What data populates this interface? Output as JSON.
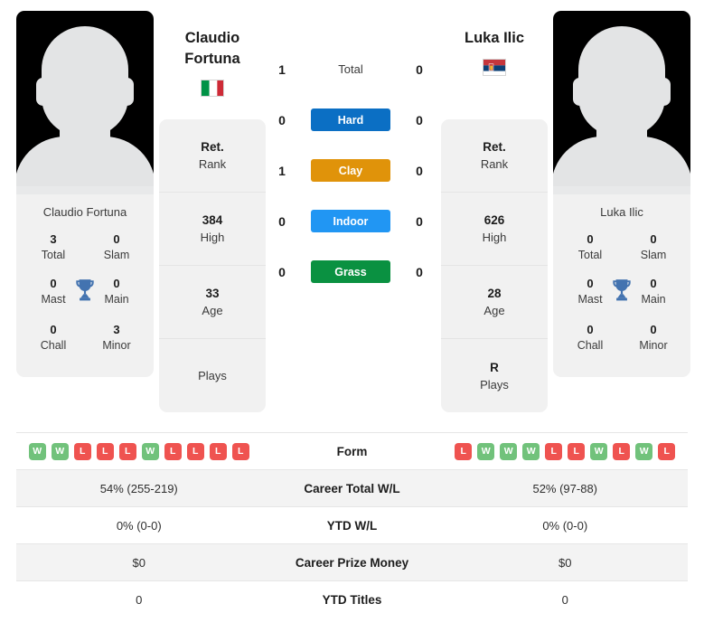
{
  "players": {
    "left": {
      "name": "Claudio Fortuna",
      "name_line1": "Claudio",
      "name_line2": "Fortuna",
      "country": "Italy",
      "flag": "italy-flag",
      "photo": "player-photo-placeholder",
      "titles": {
        "total_value": "3",
        "total_label": "Total",
        "slam_value": "0",
        "slam_label": "Slam",
        "mast_value": "0",
        "mast_label": "Mast",
        "main_value": "0",
        "main_label": "Main",
        "chall_value": "0",
        "chall_label": "Chall",
        "minor_value": "3",
        "minor_label": "Minor"
      },
      "rank": {
        "rank_value": "Ret.",
        "rank_label": "Rank",
        "high_value": "384",
        "high_label": "High",
        "age_value": "33",
        "age_label": "Age",
        "plays_value": "",
        "plays_label": "Plays"
      },
      "form": [
        "W",
        "W",
        "L",
        "L",
        "L",
        "W",
        "L",
        "L",
        "L",
        "L"
      ],
      "career_total_wl": "54% (255-219)",
      "ytd_wl": "0% (0-0)",
      "career_prize_money": "$0",
      "ytd_titles": "0"
    },
    "right": {
      "name": "Luka Ilic",
      "name_line1": "Luka Ilic",
      "name_line2": "",
      "country": "Serbia",
      "flag": "serbia-flag",
      "photo": "player-photo-placeholder",
      "titles": {
        "total_value": "0",
        "total_label": "Total",
        "slam_value": "0",
        "slam_label": "Slam",
        "mast_value": "0",
        "mast_label": "Mast",
        "main_value": "0",
        "main_label": "Main",
        "chall_value": "0",
        "chall_label": "Chall",
        "minor_value": "0",
        "minor_label": "Minor"
      },
      "rank": {
        "rank_value": "Ret.",
        "rank_label": "Rank",
        "high_value": "626",
        "high_label": "High",
        "age_value": "28",
        "age_label": "Age",
        "plays_value": "R",
        "plays_label": "Plays"
      },
      "form": [
        "L",
        "W",
        "W",
        "W",
        "L",
        "L",
        "W",
        "L",
        "W",
        "L"
      ],
      "career_total_wl": "52% (97-88)",
      "ytd_wl": "0% (0-0)",
      "career_prize_money": "$0",
      "ytd_titles": "0"
    }
  },
  "head_to_head": [
    {
      "label": "Total",
      "left": "1",
      "right": "0",
      "color": "",
      "style": "plain"
    },
    {
      "label": "Hard",
      "left": "0",
      "right": "0",
      "color": "#0b6fc4",
      "style": "bar"
    },
    {
      "label": "Clay",
      "left": "1",
      "right": "0",
      "color": "#e0930a",
      "style": "bar"
    },
    {
      "label": "Indoor",
      "left": "0",
      "right": "0",
      "color": "#2196f3",
      "style": "bar"
    },
    {
      "label": "Grass",
      "left": "0",
      "right": "0",
      "color": "#0a9141",
      "style": "bar"
    }
  ],
  "table_rows": [
    {
      "label": "Form",
      "type": "form",
      "left": "",
      "right": ""
    },
    {
      "label": "Career Total W/L",
      "type": "text",
      "left": "54% (255-219)",
      "right": "52% (97-88)"
    },
    {
      "label": "YTD W/L",
      "type": "text",
      "left": "0% (0-0)",
      "right": "0% (0-0)"
    },
    {
      "label": "Career Prize Money",
      "type": "text",
      "left": "$0",
      "right": "$0"
    },
    {
      "label": "YTD Titles",
      "type": "text",
      "left": "0",
      "right": "0"
    }
  ],
  "colors": {
    "hard": "#0b6fc4",
    "clay": "#e0930a",
    "indoor": "#2196f3",
    "grass": "#0a9141",
    "win_badge": "#71c27b",
    "loss_badge": "#ef5350",
    "trophy": "#4373b0"
  }
}
